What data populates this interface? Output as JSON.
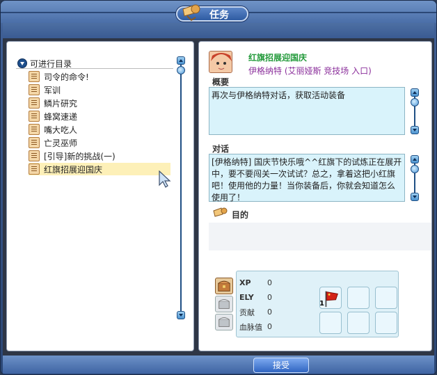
{
  "window": {
    "title": "任务"
  },
  "tree": {
    "root_label": "可进行目录",
    "items": [
      {
        "label": "司令的命令!"
      },
      {
        "label": "军训"
      },
      {
        "label": "鳞片研究"
      },
      {
        "label": "蜂窝速递"
      },
      {
        "label": "嘴大吃人"
      },
      {
        "label": "亡灵巫师"
      },
      {
        "label": "[引导]新的挑战(一)"
      },
      {
        "label": "红旗招展迎国庆",
        "selected": true
      }
    ]
  },
  "quest": {
    "title": "红旗招展迎国庆",
    "npc_location": "伊格纳特 (艾丽娅斯 竞技场 入口)",
    "summary_label": "概要",
    "summary_text": "再次与伊格纳特对话，获取活动装备",
    "dialog_label": "对话",
    "dialog_text": "[伊格纳特] 国庆节快乐哦^^红旗下的试炼正在展开中，要不要闯关一次试试？总之，拿着这把小红旗吧！使用他的力量！当你装备后，你就会知道怎么使用了！",
    "objective_label": "目的"
  },
  "reward": {
    "rows": [
      {
        "label": "XP",
        "value": "0"
      },
      {
        "label": "ELY",
        "value": "0"
      },
      {
        "label": "贡献",
        "value": "0"
      },
      {
        "label": "血脉值",
        "value": "0"
      }
    ],
    "item_count": "1"
  },
  "buttons": {
    "accept": "接受"
  },
  "icons": {
    "title": "scroll-horn-icon",
    "tree_root": "collapse-icon",
    "tree_item": "quest-scroll-icon",
    "objective": "scroll-horn-icon",
    "reward_item": "red-flag-icon"
  },
  "colors": {
    "quest_title": "#239a3b",
    "npc_location": "#8b2f9b",
    "selected_row": "#fdf0b8",
    "textbox_bg": "#d9f3fb"
  }
}
